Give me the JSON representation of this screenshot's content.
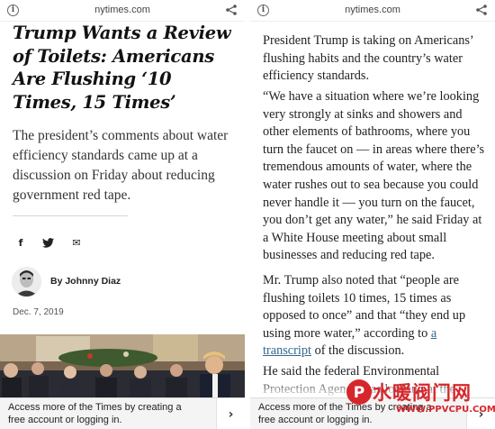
{
  "left_phone": {
    "url": "nytimes.com",
    "headline": "Trump Wants a Review of Toilets: Americans Are Flushing ‘10 Times, 15 Times’",
    "summary": "The president’s comments about water efficiency standards came up at a discussion on Friday about reducing government red tape.",
    "social_icons": [
      "facebook-icon",
      "twitter-icon",
      "email-icon"
    ],
    "social_glyphs": {
      "facebook": "f",
      "email": "✉"
    },
    "byline": "By Johnny Diaz",
    "date": "Dec. 7, 2019",
    "banner_text": "Access more of the Times by creating a free account or logging in.",
    "banner_arrow": "›"
  },
  "right_phone": {
    "url": "nytimes.com",
    "para_1": "President Trump is taking on Americans’ flushing habits and the country’s water efficiency standards.",
    "para_2": "“We have a situation where we’re looking very strongly at sinks and showers and other elements of bathrooms, where you turn the faucet on — in areas where there’s tremendous amounts of water, where the water rushes out to sea because you could never handle it — you turn on the faucet, you don’t get any water,” he said Friday at a White House meeting about small businesses and reducing red tape.",
    "para_3_before_link": "Mr. Trump also noted that “people are flushing toilets 10 times, 15 times as opposed to once” and that “they end up using more water,” according to ",
    "para_3_link": "a transcript",
    "para_3_after_link": " of the discussion.",
    "para_4": "He said the federal Environmental Protection Agency was looking at the",
    "banner_text": "Access more of the Times by creating a free account or logging in.",
    "banner_arrow": "›"
  },
  "watermark": {
    "logo_letter": "P",
    "text": "水暖阀门网",
    "url": "WWW.PPVCPU.COM"
  },
  "colors": {
    "link": "#326891",
    "watermark": "#d6262b",
    "banner_bg": "#f4f4f4"
  }
}
